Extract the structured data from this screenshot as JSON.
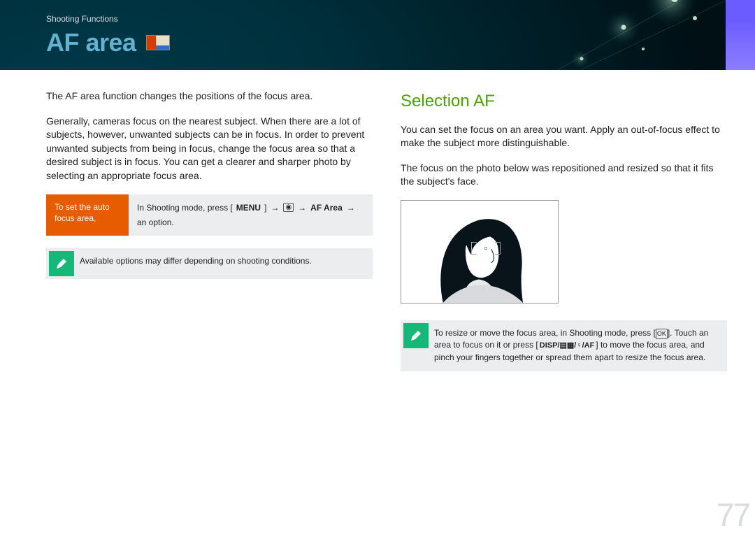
{
  "header": {
    "breadcrumb": "Shooting Functions",
    "title": "AF area"
  },
  "left": {
    "intro": "The AF area function changes the positions of the focus area.",
    "body": "Generally, cameras focus on the nearest subject. When there are a lot of subjects, however, unwanted subjects can be in focus. In order to prevent unwanted subjects from being in focus, change the focus area so that a desired subject is in focus. You can get a clearer and sharper photo by selecting an appropriate focus area.",
    "instruction": {
      "label": "To set the auto focus area,",
      "prefix": "In Shooting mode, press [",
      "menu_key": "MENU",
      "mid1": "] ",
      "arrow": "→",
      "camera_icon_name": "camera-icon",
      "af_area_bold": "AF Area",
      "suffix": "an option."
    },
    "note": "Available options may differ depending on shooting conditions."
  },
  "right": {
    "heading": "Selection AF",
    "p1": "You can set the focus on an area you want. Apply an out-of-focus effect to make the subject more distinguishable.",
    "p2": "The focus on the photo below was repositioned and resized so that it fits the subject's face.",
    "note2": {
      "t1": "To resize or move the focus area, in Shooting mode, press [",
      "ok_key": "OK",
      "t2": "]. Touch an area to focus on it or press [",
      "keys": "DISP/▤▦/♀/AF",
      "t3": "] to move the focus area, and pinch your fingers together or spread them apart to resize the focus area."
    }
  },
  "page_number": "77"
}
